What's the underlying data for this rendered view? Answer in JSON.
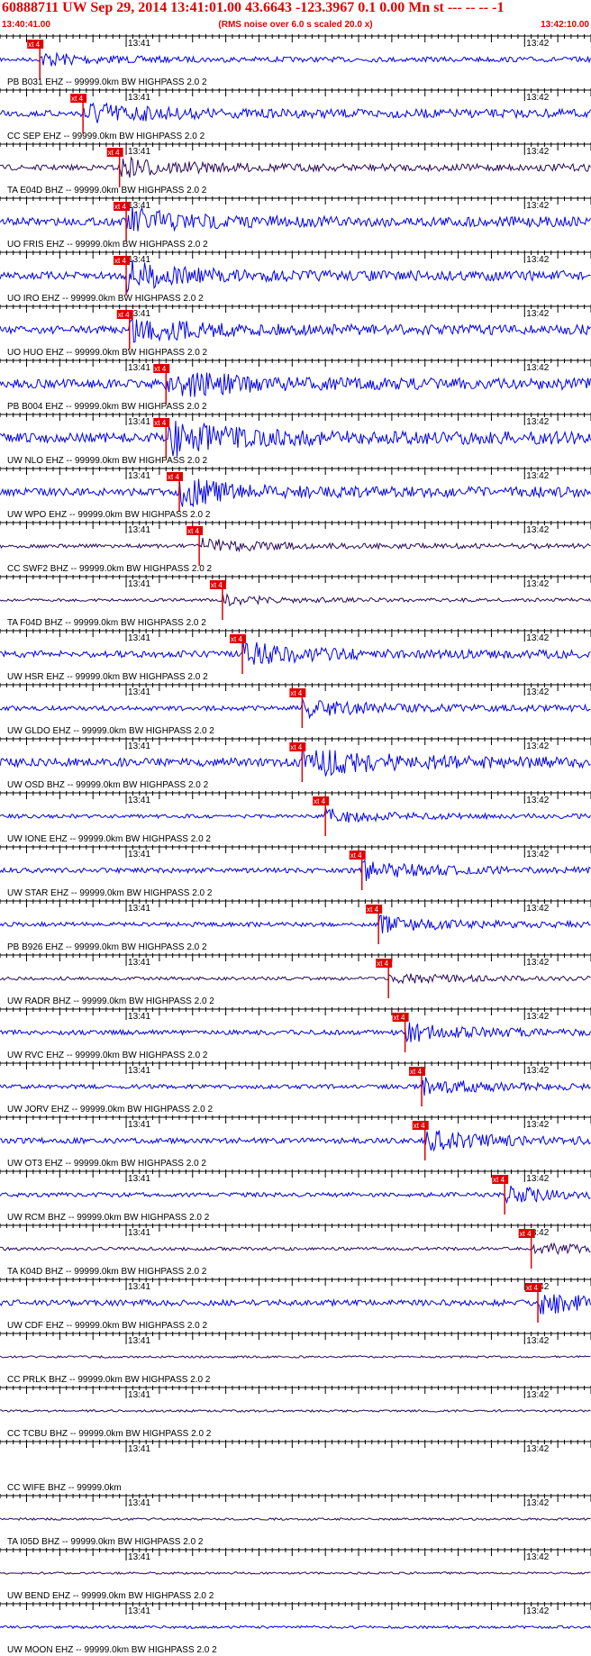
{
  "header": {
    "title": "60888711 UW Sep 29, 2014 13:41:01.00   43.6643 -123.3967  0.1 0.00 Mn st --- -- --  -1",
    "start_time": "13:40:41.00",
    "note": "(RMS noise over 6.0 s scaled 20.0 x)",
    "end_time": "13:42:10.00"
  },
  "colors": {
    "trace_blue": "#0000ee",
    "trace_purple": "#2a0a5a",
    "pick_red": "#e00000",
    "axis_black": "#000000"
  },
  "chart_data": {
    "type": "line",
    "title": "60888711 UW Sep 29, 2014 13:41:01.00   43.6643 -123.3967  0.1 0.00 Mn st --- -- --  -1",
    "x_range": [
      "13:40:41.00",
      "13:42:10.00"
    ],
    "time_labels": [
      "13:41",
      "13:42"
    ],
    "pick_label": "xt 4",
    "series": [
      {
        "label": "PB B031 EHZ -- 99999.0km BW  HIGHPASS  2.0  2",
        "color": "#0000ee",
        "pick": "13:40:47.0",
        "amp": 0.35
      },
      {
        "label": "CC SEP EHZ -- 99999.0km BW  HIGHPASS  2.0  2",
        "color": "#0000ee",
        "pick": "13:40:53.5",
        "amp": 0.6
      },
      {
        "label": "TA E04D BHZ -- 99999.0km BW  HIGHPASS  2.0  2",
        "color": "#2a0a5a",
        "pick": "13:40:59.0",
        "amp": 0.5
      },
      {
        "label": "UO FRIS EHZ -- 99999.0km BW  HIGHPASS  2.0  2",
        "color": "#0000ee",
        "pick": "13:41:00.0",
        "amp": 0.7
      },
      {
        "label": "UO IRO EHZ -- 99999.0km BW  HIGHPASS  2.0  2",
        "color": "#0000ee",
        "pick": "13:41:00.0",
        "amp": 0.7
      },
      {
        "label": "UO HUO EHZ -- 99999.0km BW  HIGHPASS  2.0  2",
        "color": "#0000ee",
        "pick": "13:41:00.5",
        "amp": 0.7
      },
      {
        "label": "PB B004 EHZ -- 99999.0km BW  HIGHPASS  2.0  2",
        "color": "#0000ee",
        "pick": "13:41:06.0",
        "amp": 0.8
      },
      {
        "label": "UW NLO EHZ -- 99999.0km BW  HIGHPASS  2.0  2",
        "color": "#0000ee",
        "pick": "13:41:06.0",
        "amp": 0.9
      },
      {
        "label": "UW WPO EHZ -- 99999.0km BW  HIGHPASS  2.0  2",
        "color": "#0000ee",
        "pick": "13:41:08.0",
        "amp": 0.7
      },
      {
        "label": "CC SWF2 BHZ -- 99999.0km BW  HIGHPASS  2.0  2",
        "color": "#2a0a5a",
        "pick": "13:41:11.0",
        "amp": 0.35
      },
      {
        "label": "TA F04D BHZ -- 99999.0km BW  HIGHPASS  2.0  2",
        "color": "#2a0a5a",
        "pick": "13:41:14.5",
        "amp": 0.25
      },
      {
        "label": "UW HSR EHZ -- 99999.0km BW  HIGHPASS  2.0  2",
        "color": "#0000ee",
        "pick": "13:41:17.5",
        "amp": 0.6
      },
      {
        "label": "UW GLDO EHZ -- 99999.0km BW  HIGHPASS  2.0  2",
        "color": "#0000ee",
        "pick": "13:41:26.5",
        "amp": 0.45
      },
      {
        "label": "UW OSD BHZ -- 99999.0km BW  HIGHPASS  2.0  2",
        "color": "#0000ee",
        "pick": "13:41:26.5",
        "amp": 0.8
      },
      {
        "label": "UW IONE EHZ -- 99999.0km BW  HIGHPASS  2.0  2",
        "color": "#0000ee",
        "pick": "13:41:30.0",
        "amp": 0.35
      },
      {
        "label": "UW STAR EHZ -- 99999.0km BW  HIGHPASS  2.0  2",
        "color": "#0000ee",
        "pick": "13:41:35.5",
        "amp": 0.45
      },
      {
        "label": "PB B926 EHZ -- 99999.0km BW  HIGHPASS  2.0  2",
        "color": "#0000ee",
        "pick": "13:41:38.0",
        "amp": 0.4
      },
      {
        "label": "UW RADR BHZ -- 99999.0km BW  HIGHPASS  2.0  2",
        "color": "#2a0a5a",
        "pick": "13:41:39.5",
        "amp": 0.3
      },
      {
        "label": "UW RVC EHZ -- 99999.0km BW  HIGHPASS  2.0  2",
        "color": "#0000ee",
        "pick": "13:41:42.0",
        "amp": 0.45
      },
      {
        "label": "UW JORV EHZ -- 99999.0km BW  HIGHPASS  2.0  2",
        "color": "#0000ee",
        "pick": "13:41:44.5",
        "amp": 0.4
      },
      {
        "label": "UW OT3 EHZ -- 99999.0km BW  HIGHPASS  2.0  2",
        "color": "#0000ee",
        "pick": "13:41:45.0",
        "amp": 0.5
      },
      {
        "label": "UW RCM BHZ -- 99999.0km BW  HIGHPASS  2.0  2",
        "color": "#0000ee",
        "pick": "13:41:57.0",
        "amp": 0.4
      },
      {
        "label": "TA K04D BHZ -- 99999.0km BW  HIGHPASS  2.0  2",
        "color": "#2a0a5a",
        "pick": "13:41:61.0",
        "amp": 0.3
      },
      {
        "label": "UW CDF EHZ -- 99999.0km BW  HIGHPASS  2.0  2",
        "color": "#0000ee",
        "pick": "13:42:02.0",
        "amp": 0.55
      },
      {
        "label": "CC PRLK BHZ -- 99999.0km BW  HIGHPASS  2.0  2",
        "color": "#2a0a5a",
        "pick": null,
        "amp": 0.2
      },
      {
        "label": "CC TCBU BHZ -- 99999.0km BW  HIGHPASS  2.0  2",
        "color": "#2a0a5a",
        "pick": null,
        "amp": 0.2
      },
      {
        "label": "CC WIFE BHZ -- 99999.0km",
        "color": "#2a0a5a",
        "pick": null,
        "amp": 0.0
      },
      {
        "label": "TA I05D BHZ -- 99999.0km BW  HIGHPASS  2.0  2",
        "color": "#2a0a5a",
        "pick": null,
        "amp": 0.2
      },
      {
        "label": "UW BEND EHZ -- 99999.0km BW  HIGHPASS  2.0  2",
        "color": "#2a0a5a",
        "pick": null,
        "amp": 0.2
      },
      {
        "label": "UW MOON EHZ -- 99999.0km BW  HIGHPASS  2.0  2",
        "color": "#0000ee",
        "pick": null,
        "amp": 0.25
      }
    ]
  }
}
